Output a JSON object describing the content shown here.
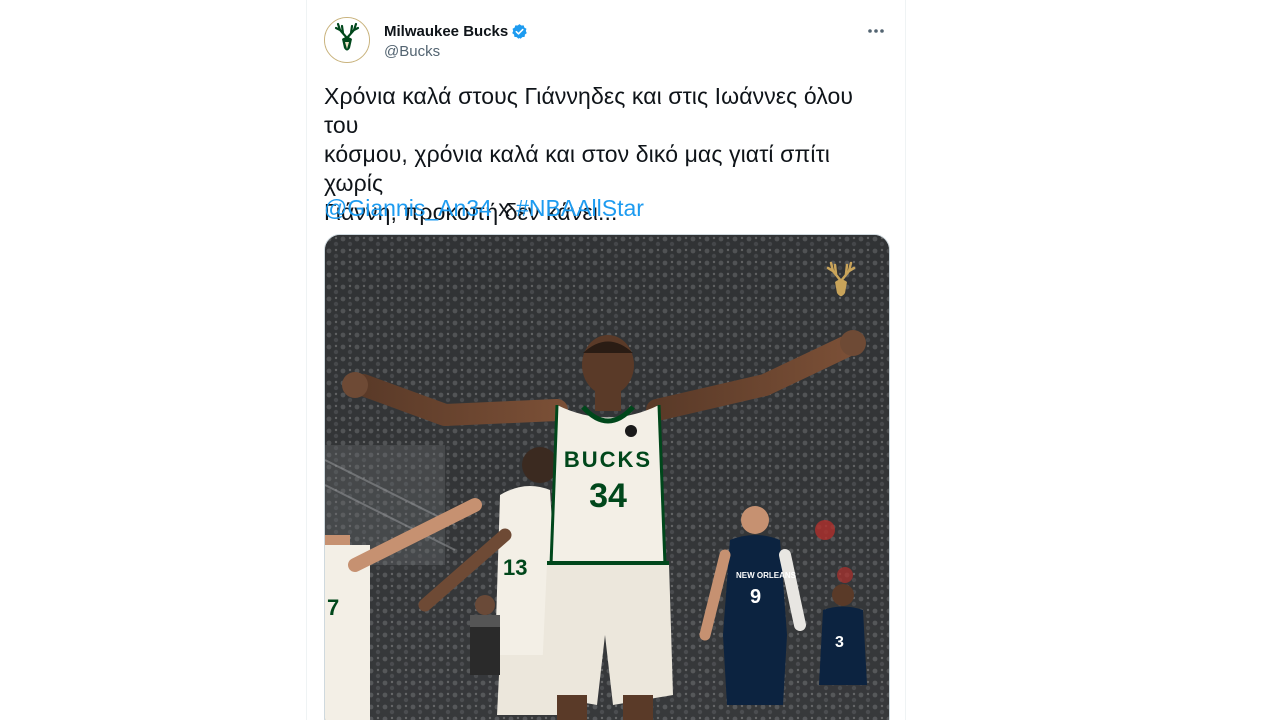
{
  "tweet": {
    "author": {
      "display_name": "Milwaukee Bucks",
      "handle": "@Bucks",
      "verified": true,
      "avatar_icon": "bucks-deer-logo"
    },
    "more_icon": "more-horizontal-icon",
    "text_lines": [
      "Χρόνια καλά στους Γιάννηδες και στις Ιωάννες όλου του",
      "κόσμου, χρόνια καλά και στον δικό μας γιατί σπίτι χωρίς",
      "Γιάννη, προκοπή δεν κάνει..."
    ],
    "mention": "@Giannis_An34",
    "separator": "x",
    "hashtag": "#NBAAllStar",
    "media": {
      "jersey_lettering": "BUCKS",
      "jersey_number": "34",
      "opponent_lettering": "NEW ORLEANS",
      "opponent_number_1": "9",
      "opponent_number_2": "3",
      "teammate_number_1": "13",
      "teammate_number_2": "7",
      "watermark_icon": "bucks-deer-logo"
    }
  },
  "colors": {
    "link": "#1d9bf0",
    "text": "#0f1419",
    "secondary": "#536471",
    "bucks_green": "#00471b",
    "bucks_cream": "#eee1c6",
    "verified": "#1d9bf0"
  }
}
